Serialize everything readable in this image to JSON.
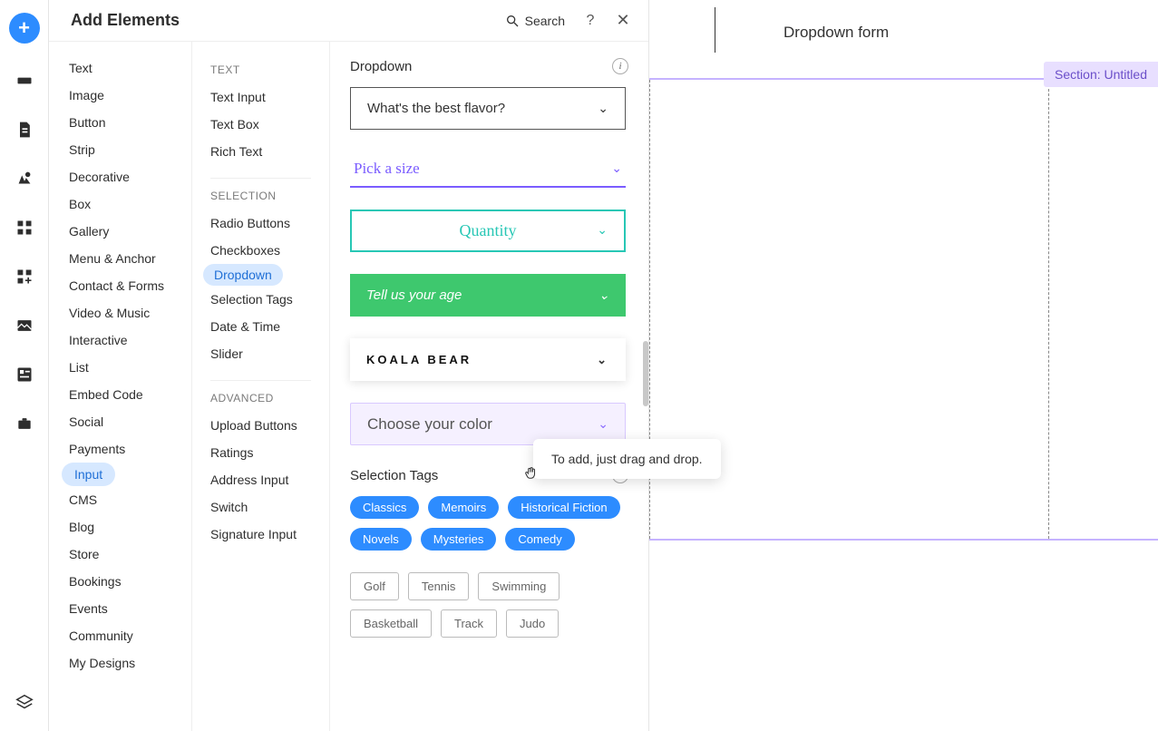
{
  "panel": {
    "title": "Add Elements",
    "search_label": "Search"
  },
  "col1": {
    "items": [
      "Text",
      "Image",
      "Button",
      "Strip",
      "Decorative",
      "Box",
      "Gallery",
      "Menu & Anchor",
      "Contact & Forms",
      "Video & Music",
      "Interactive",
      "List",
      "Embed Code",
      "Social",
      "Payments",
      "Input",
      "CMS",
      "Blog",
      "Store",
      "Bookings",
      "Events",
      "Community",
      "My Designs"
    ],
    "active_index": 15
  },
  "col2": {
    "groups": [
      {
        "title": "TEXT",
        "items": [
          "Text Input",
          "Text Box",
          "Rich Text"
        ]
      },
      {
        "title": "SELECTION",
        "items": [
          "Radio Buttons",
          "Checkboxes",
          "Dropdown",
          "Selection Tags",
          "Date & Time",
          "Slider"
        ],
        "active_index": 2
      },
      {
        "title": "ADVANCED",
        "items": [
          "Upload Buttons",
          "Ratings",
          "Address Input",
          "Switch",
          "Signature Input"
        ]
      }
    ]
  },
  "col3": {
    "dropdown_heading": "Dropdown",
    "dropdowns": [
      "What's the best flavor?",
      "Pick a size",
      "Quantity",
      "Tell us your age",
      "KOALA BEAR",
      "Choose your color"
    ],
    "selection_tags_heading": "Selection Tags",
    "tags_blue": [
      "Classics",
      "Memoirs",
      "Historical Fiction",
      "Novels",
      "Mysteries",
      "Comedy"
    ],
    "tags_outline": [
      "Golf",
      "Tennis",
      "Swimming",
      "Basketball",
      "Track",
      "Judo"
    ]
  },
  "tooltip": "To add, just drag and drop.",
  "canvas": {
    "title": "Dropdown form",
    "section_label": "Section: Untitled"
  }
}
